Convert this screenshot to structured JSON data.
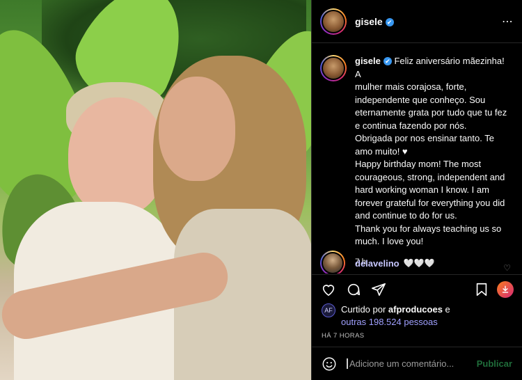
{
  "post": {
    "username": "gisele",
    "verified_mark": "✔",
    "more_icon": "⋯",
    "caption_lines": [
      "Feliz aniversário mãezinha! A",
      "mulher mais corajosa, forte,",
      "independente que conheço. Sou",
      "eternamente grata por tudo que tu fez",
      "e continua fazendo por nós.",
      "Obrigada por nos ensinar tanto. Te",
      "amo muito! ♥",
      "Happy birthday mom! The most",
      "courageous, strong, independent and",
      "hard working woman I know. I am",
      "forever grateful for everything you did",
      "and continue to do for us.",
      "Thank you for always teaching us so",
      "much. I love you!"
    ],
    "caption_time": "7 h"
  },
  "comment": {
    "username": "delavelino",
    "text": "🤍🤍🤍",
    "like_icon": "♡"
  },
  "likes": {
    "prefix": "Curtido por ",
    "user": "afproducoes",
    "mid": " e",
    "others": "outras 198.524 pessoas"
  },
  "timestamp": "HÁ 7 HORAS",
  "add_comment": {
    "placeholder": "Adicione um comentário...",
    "publish": "Publicar"
  },
  "colors": {
    "background": "#000000",
    "border": "#262626",
    "link": "#a0a0ff",
    "publish": "#1f6d3a"
  },
  "icons": [
    "heart-icon",
    "comment-icon",
    "share-icon",
    "bookmark-icon",
    "download-icon",
    "emoji-icon"
  ]
}
